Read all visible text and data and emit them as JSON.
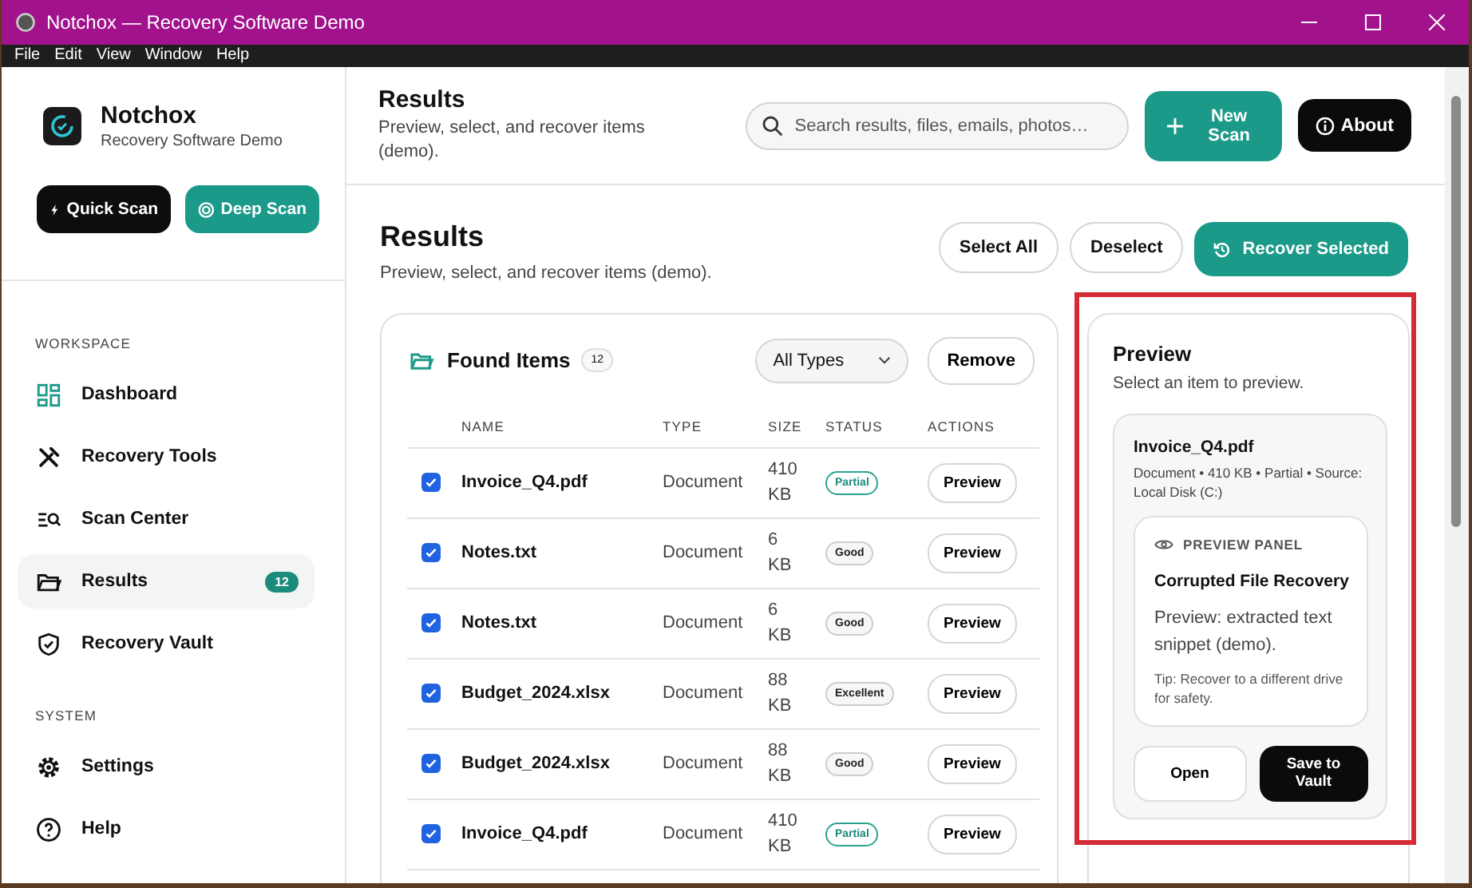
{
  "window": {
    "title": "Notchox — Recovery Software Demo"
  },
  "menu": [
    "File",
    "Edit",
    "View",
    "Window",
    "Help"
  ],
  "brand": {
    "name": "Notchox",
    "subtitle": "Recovery Software Demo"
  },
  "scan_buttons": [
    {
      "label": "Quick Scan",
      "kind": "quick"
    },
    {
      "label": "Deep Scan",
      "kind": "deep"
    }
  ],
  "sidebar": {
    "sections": [
      {
        "title": "WORKSPACE",
        "items": [
          {
            "label": "Dashboard",
            "selected": false
          },
          {
            "label": "Recovery Tools",
            "selected": false
          },
          {
            "label": "Scan Center",
            "selected": false
          },
          {
            "label": "Results",
            "selected": true,
            "badge": "12"
          },
          {
            "label": "Recovery Vault",
            "selected": false
          }
        ]
      },
      {
        "title": "SYSTEM",
        "items": [
          {
            "label": "Settings",
            "selected": false
          },
          {
            "label": "Help",
            "selected": false
          }
        ]
      }
    ]
  },
  "header": {
    "title": "Results",
    "subtitle": "Preview, select, and recover items (demo).",
    "search": {
      "placeholder": "Search results, files, emails, photos…"
    },
    "new_scan": "New Scan",
    "about": "About"
  },
  "page": {
    "title": "Results",
    "subtitle": "Preview, select, and recover items (demo).",
    "actions": [
      {
        "label": "Select All",
        "kind": "outline"
      },
      {
        "label": "Deselect",
        "kind": "outline"
      },
      {
        "label": "Recover Selected",
        "kind": "primary"
      }
    ]
  },
  "found": {
    "title": "Found Items",
    "count": "12",
    "filter": "All Types",
    "remove": "Remove",
    "columns": [
      "NAME",
      "TYPE",
      "SIZE",
      "STATUS",
      "ACTIONS"
    ],
    "rows": [
      {
        "checked": true,
        "name": "Invoice_Q4.pdf",
        "type": "Document",
        "size": "410 KB",
        "status": "Partial",
        "kind": "partial",
        "action": "Preview"
      },
      {
        "checked": true,
        "name": "Notes.txt",
        "type": "Document",
        "size": "6 KB",
        "status": "Good",
        "kind": "neutral",
        "action": "Preview"
      },
      {
        "checked": true,
        "name": "Notes.txt",
        "type": "Document",
        "size": "6 KB",
        "status": "Good",
        "kind": "neutral",
        "action": "Preview"
      },
      {
        "checked": true,
        "name": "Budget_2024.xlsx",
        "type": "Document",
        "size": "88 KB",
        "status": "Excellent",
        "kind": "neutral",
        "action": "Preview"
      },
      {
        "checked": true,
        "name": "Budget_2024.xlsx",
        "type": "Document",
        "size": "88 KB",
        "status": "Good",
        "kind": "neutral",
        "action": "Preview"
      },
      {
        "checked": true,
        "name": "Invoice_Q4.pdf",
        "type": "Document",
        "size": "410 KB",
        "status": "Partial",
        "kind": "partial",
        "action": "Preview"
      }
    ]
  },
  "preview": {
    "title": "Preview",
    "hint": "Select an item to preview.",
    "file": {
      "name": "Invoice_Q4.pdf",
      "meta": "Document • 410 KB • Partial • Source: Local Disk (C:)"
    },
    "panel": {
      "label": "PREVIEW PANEL",
      "title": "Corrupted File Recovery",
      "text": "Preview: extracted text snippet (demo).",
      "tip": "Tip: Recover to a different drive for safety."
    },
    "buttons": [
      {
        "label": "Open",
        "kind": "outline"
      },
      {
        "label": "Save to Vault",
        "kind": "dark"
      }
    ]
  }
}
